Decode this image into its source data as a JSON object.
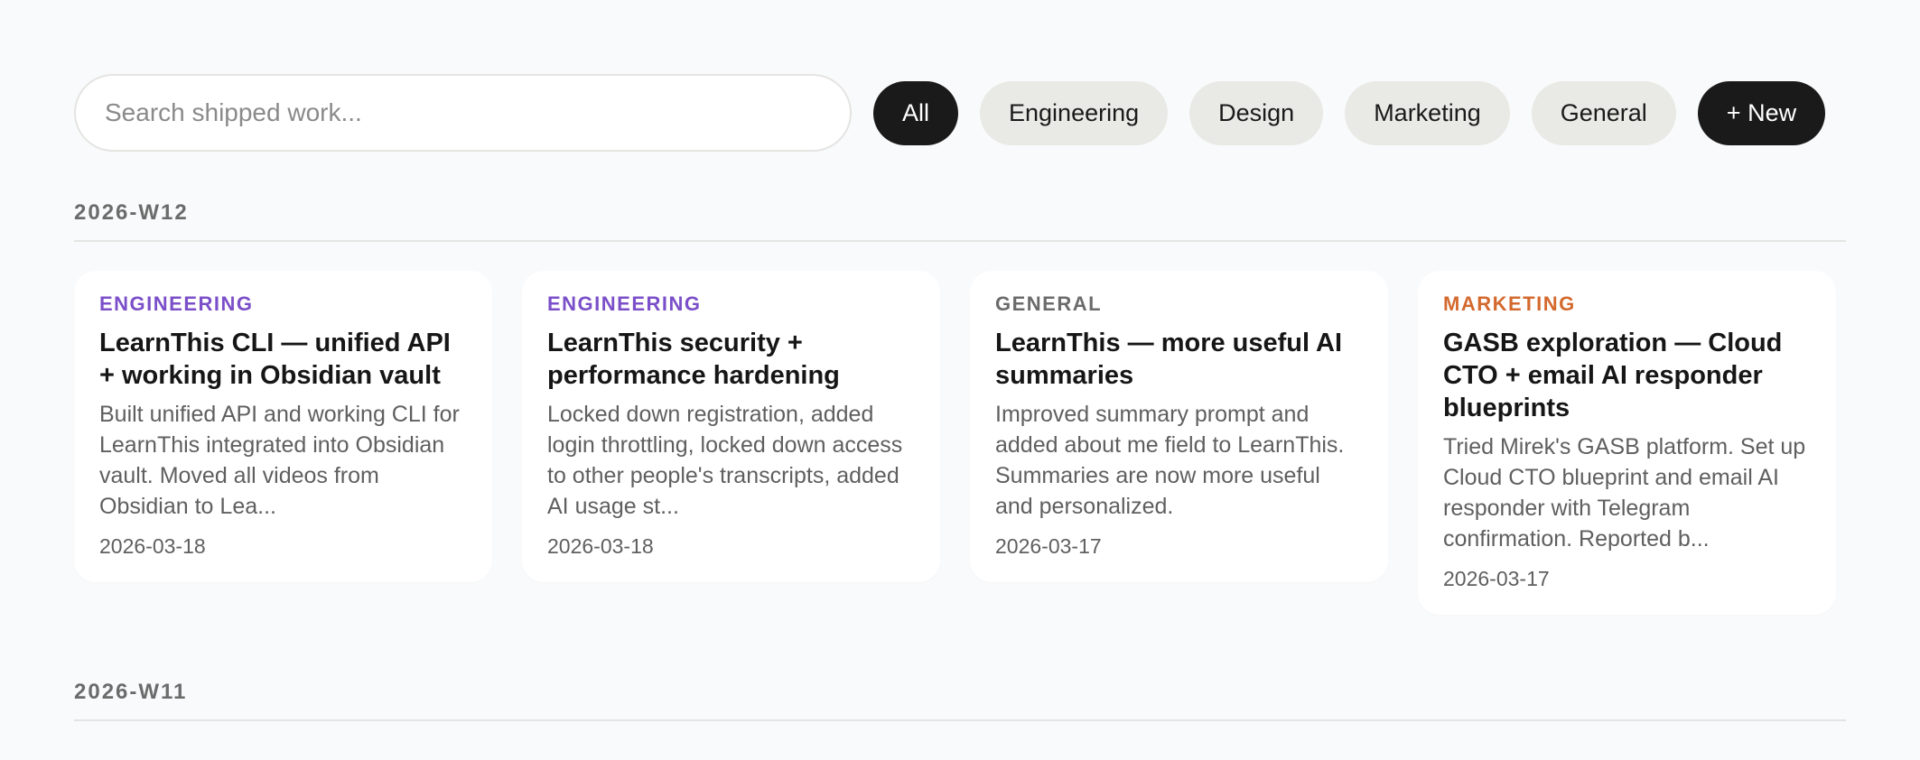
{
  "search": {
    "placeholder": "Search shipped work...",
    "value": ""
  },
  "filters": [
    {
      "label": "All",
      "active": true
    },
    {
      "label": "Engineering",
      "active": false
    },
    {
      "label": "Design",
      "active": false
    },
    {
      "label": "Marketing",
      "active": false
    },
    {
      "label": "General",
      "active": false
    }
  ],
  "new_button": {
    "label": "+ New"
  },
  "category_colors": {
    "engineering": "#7b4fc9",
    "general": "#6b6b6b",
    "marketing": "#d4692e"
  },
  "weeks": [
    {
      "label": "2026-W12",
      "cards": [
        {
          "category": "ENGINEERING",
          "category_color": "#7b4fc9",
          "title": "LearnThis CLI — unified API + working in Obsidian vault",
          "summary": "Built unified API and working CLI for LearnThis integrated into Obsidian vault. Moved all videos from Obsidian to Lea...",
          "date": "2026-03-18"
        },
        {
          "category": "ENGINEERING",
          "category_color": "#7b4fc9",
          "title": "LearnThis security + performance hardening",
          "summary": "Locked down registration, added login throttling, locked down access to other people's transcripts, added AI usage st...",
          "date": "2026-03-18"
        },
        {
          "category": "GENERAL",
          "category_color": "#6b6b6b",
          "title": "LearnThis — more useful AI summaries",
          "summary": "Improved summary prompt and added about me field to LearnThis. Summaries are now more useful and personalized.",
          "date": "2026-03-17"
        },
        {
          "category": "MARKETING",
          "category_color": "#d4692e",
          "title": "GASB exploration — Cloud CTO + email AI responder blueprints",
          "summary": "Tried Mirek's GASB platform. Set up Cloud CTO blueprint and email AI responder with Telegram confirmation. Reported b...",
          "date": "2026-03-17"
        }
      ]
    },
    {
      "label": "2026-W11",
      "cards": []
    }
  ]
}
